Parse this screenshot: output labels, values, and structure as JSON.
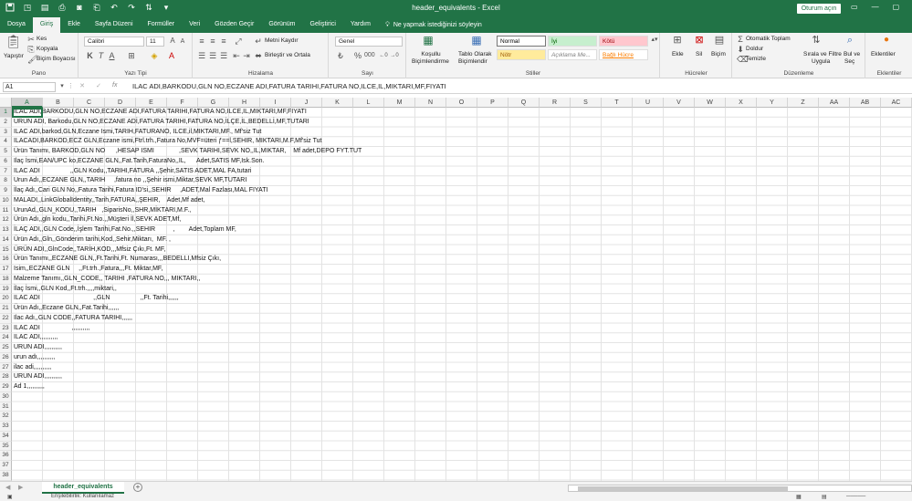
{
  "window": {
    "title": "header_equivalents - Excel",
    "signin": "Oturum açın",
    "controls": [
      "—",
      "▢",
      "✕"
    ]
  },
  "tabs": [
    {
      "label": "Dosya",
      "active": false
    },
    {
      "label": "Giriş",
      "active": true
    },
    {
      "label": "Ekle",
      "active": false
    },
    {
      "label": "Sayfa Düzeni",
      "active": false
    },
    {
      "label": "Formüller",
      "active": false
    },
    {
      "label": "Veri",
      "active": false
    },
    {
      "label": "Gözden Geçir",
      "active": false
    },
    {
      "label": "Görünüm",
      "active": false
    },
    {
      "label": "Geliştirici",
      "active": false
    },
    {
      "label": "Yardım",
      "active": false
    }
  ],
  "tellme": "Ne yapmak istediğinizi söyleyin",
  "ribbon": {
    "clipboard": {
      "label": "Pano",
      "paste": "Yapıştır",
      "cut": "Kes",
      "copy": "Kopyala",
      "format_painter": "Biçim Boyacısı"
    },
    "font": {
      "label": "Yazı Tipi",
      "name": "Calibri",
      "size": "11"
    },
    "alignment": {
      "label": "Hizalama",
      "wrap": "Metni Kaydır",
      "merge": "Birleştir ve Ortala"
    },
    "number": {
      "label": "Sayı",
      "format": "Genel"
    },
    "styles": {
      "label": "Stiller",
      "conditional": [
        "Koşullu",
        "Biçimlendirme"
      ],
      "table": [
        "Tablo Olarak",
        "Biçimlendir"
      ],
      "cells": [
        {
          "label": "Normal",
          "bg": "#ffffff",
          "fg": "#000000"
        },
        {
          "label": "İyi",
          "bg": "#c6efce",
          "fg": "#006100"
        },
        {
          "label": "Kötü",
          "bg": "#ffc7ce",
          "fg": "#9c0006"
        },
        {
          "label": "Nötr",
          "bg": "#ffeb9c",
          "fg": "#9c5700"
        },
        {
          "label": "Açıklama Me...",
          "bg": "#ffffff",
          "fg": "#7f7f7f"
        },
        {
          "label": "Bağlı Hücre",
          "bg": "#ffffff",
          "fg": "#fa7d00"
        }
      ]
    },
    "cells": {
      "label": "Hücreler",
      "insert": "Ekle",
      "delete": "Sil",
      "format": "Biçim"
    },
    "editing": {
      "label": "Düzenleme",
      "autosum": "Otomatik Toplam",
      "fill": "Doldur",
      "clear": "Temizle",
      "sort": [
        "Sırala ve Filtre",
        "Uygula"
      ],
      "find": [
        "Bul ve",
        "Seç"
      ]
    },
    "addins": {
      "label": "Eklentiler",
      "item": "Eklentiler"
    }
  },
  "formula_bar": {
    "name_box": "A1",
    "fx": "fx",
    "content": "ILAC ADI,BARKODU,GLN NO,ECZANE ADI,FATURA TARIHI,FATURA NO,ILCE,IL,MIKTARI,MF,FIYATI"
  },
  "columns": [
    "A",
    "B",
    "C",
    "D",
    "E",
    "F",
    "G",
    "H",
    "I",
    "J",
    "K",
    "L",
    "M",
    "N",
    "O",
    "P",
    "Q",
    "R",
    "S",
    "T",
    "U",
    "V",
    "W",
    "X",
    "Y",
    "Z",
    "AA",
    "AB",
    "AC"
  ],
  "rows": [
    "ILAC ADI,BARKODU,GLN NO,ECZANE ADI,FATURA TARIHI,FATURA NO,ILCE,IL,MIKTARI,MF,FIYATI",
    "URUN ADI, Barkodu,GLN NO,ECZANE ADİ,FATURA TARIHI,FATURA NO,İLÇE,İL,BEDELLİ,MF,TUTARI",
    "ILAC ADI,barkod,GLN,Eczane Ismi,TARIH,FATURANO, ILCE,il,MIKTARI,MF., Mf'siz Tut",
    "ILACADI,BARKOD,ECZ GLN,Eczane ismi,Ftrl.trh.,Fatura No,MVF=üteri ƒ==l,SEHIR, MIKTARI,M.F,Mf'siz Tut",
    "Ürün Tanımı, BARKOD,GLN NO      ,HESAP ISMI              ,SEVK TARIHI,SEVK NO,,IL,MIKTAR,    Mf adet,DEPO FYT.TUT",
    "Ilaç İsmi,EAN/UPC ko,ECZANE GLN,,Fat.Tarih,FaturaNo,,IL,      Adet,SATIS MF,Isk.Son.",
    "ILAC ADI                 ,,GLN Kodu,,TARIHI,FATURA ,,Şehir,SATIS ADET,MAL FA,tutari",
    "Urun Adı,,ECZANE GLN,,TARIH     ,fatura no ,,Şehir ismi,Miktar,SEVK MF,TUTARI",
    "İlaç Adı,,Cari GLN No,,Fatura Tarihi,Fatura ID'si,,SEHIR     ,ADET,Mal Fazlası,MAL FIYATI",
    "MALADI,,LinkGlobalIdentity,,Tarih,FATURA,,ŞEHIR,    Adet,Mf adet,",
    "UrunAd,,GLN_KODU,,TARIH   ,SiparisNo,,SHR,MİKTARI,M.F.,",
    "Ürün Adı,,gln kodu,,Tarihi,Ft.No.,,Müşteri İl,SEVK ADET,Mf,",
    "İLAÇ ADI,,GLN Code,,İşlem Tarihi,Fat.No.,,SEHIR          ,        Adet,Toplam MF,",
    "Ürün Adı,,Gln,,Gönderim tarihi,Kod,,Sehir,Miktarı,  MF. ,",
    "ÜRÜN ADI,,GlnCode,,TARİH,KOD,,,Mfsiz Çıkı,Ft. MF,",
    "Ürün Tanımı,,ECZANE GLN,,Ft.Tarihi,Ft. Numarası,,,BEDELLI,Mfsiz Çıkı,",
    "Isim,,ECZANE GLN     ,,Ft.trh.,Fatura,,,Ft. Miktar,MF,",
    "Malzeme Tanımı,,GLN_CODE,, TARIHI ,FATURA NO,,, MIKTARI,,",
    "İlaç İsmi,,GLN Kod,,Ft.trh.,,,,miktari,,",
    "ILAC ADI                              ,,GLN                 ,,Ft. Tarihi,,,,,,",
    "Ürün Adı,,Eczane GLN,,Fat.Tarihi,,,,,,",
    "Ilac Adı,,GLN CODE,,FATURA TARIHI,,,,,,",
    "ILAC ADI                  ,,,,,,,,,,",
    "ILAC ADI,,,,,,,,,,",
    "URUN ADI,,,,,,,,,,",
    "urun adı,,,,,,,,,,",
    "ilac adi,,,,,,,,,,",
    "URUN ADI,,,,,,,,,,",
    "Ad 1,,,,,,,,,,",
    "",
    "",
    "",
    "",
    "",
    "",
    "",
    "",
    "",
    "",
    ""
  ],
  "sheet_tab": "header_equivalents",
  "status": "Erişilebilirlik: Kullanılamaz",
  "colors": {
    "accent": "#217346"
  }
}
